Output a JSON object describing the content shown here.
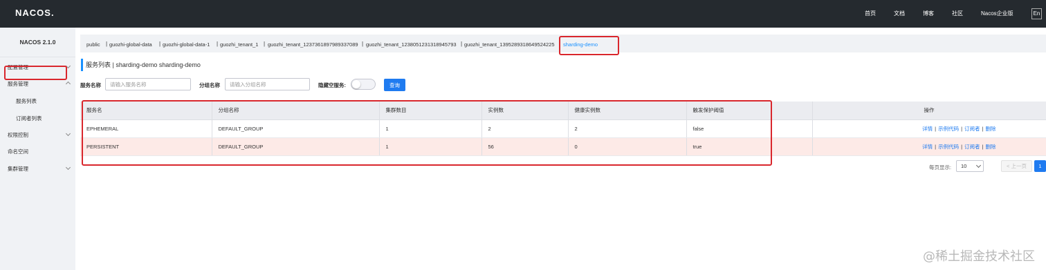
{
  "app": {
    "logo": "NACOS.",
    "version_title": "NACOS 2.1.0"
  },
  "topnav": {
    "home": "首页",
    "docs": "文档",
    "blog": "博客",
    "community": "社区",
    "enterprise": "Nacos企业版",
    "lang": "En"
  },
  "sidebar": {
    "config": "配置管理",
    "service": "服务管理",
    "service_list": "服务列表",
    "subscriber_list": "订阅者列表",
    "auth": "权限控制",
    "namespace": "命名空间",
    "cluster": "集群管理"
  },
  "namespaces": [
    "public",
    "guozhi-global-data",
    "guozhi-global-data-1",
    "guozhi_tenant_1",
    "guozhi_tenant_1237361897989337089",
    "guozhi_tenant_1238051231318945793",
    "guozhi_tenant_1395289318649524225",
    "sharding-demo"
  ],
  "page": {
    "heading": "服务列表  |  sharding-demo  sharding-demo"
  },
  "filters": {
    "service_name_label": "服务名称",
    "service_name_placeholder": "请输入服务名称",
    "group_name_label": "分组名称",
    "group_name_placeholder": "请输入分组名称",
    "hide_empty_label": "隐藏空服务:",
    "search_label": "查询"
  },
  "table": {
    "headers": [
      "服务名",
      "分组名称",
      "集群数目",
      "实例数",
      "健康实例数",
      "触发保护阈值",
      "操作"
    ],
    "rows": [
      {
        "service": "EPHEMERAL",
        "group": "DEFAULT_GROUP",
        "clusters": "1",
        "instances": "2",
        "healthy": "2",
        "threshold": "false"
      },
      {
        "service": "PERSISTENT",
        "group": "DEFAULT_GROUP",
        "clusters": "1",
        "instances": "56",
        "healthy": "0",
        "threshold": "true"
      }
    ],
    "ops": {
      "detail": "详情",
      "sample_code": "示例代码",
      "subscriber": "订阅者",
      "delete": "删除",
      "sep": "|"
    }
  },
  "pagination": {
    "size_label": "每页显示:",
    "size": "10",
    "prev": "< 上一页",
    "current": "1"
  },
  "watermark": "@稀土掘金技术社区",
  "colors": {
    "topbar": "#252a2f",
    "accent": "#1f7bf0",
    "highlight": "#d9262c",
    "pink_row": "#fdeae7"
  }
}
